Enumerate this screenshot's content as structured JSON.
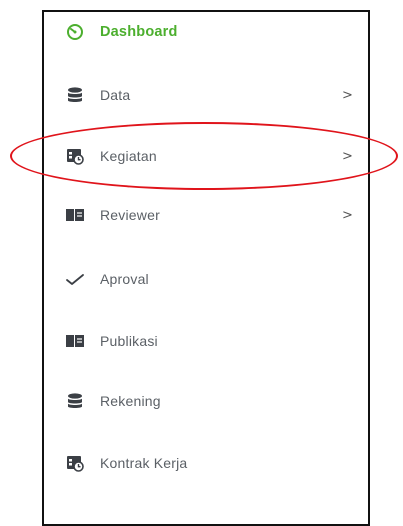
{
  "sidebar": {
    "items": [
      {
        "label": "Dashboard",
        "icon": "dashboard-gauge-icon",
        "chevron": ""
      },
      {
        "label": "Data",
        "icon": "database-icon",
        "chevron": ">"
      },
      {
        "label": "Kegiatan",
        "icon": "calendar-clock-icon",
        "chevron": ">"
      },
      {
        "label": "Reviewer",
        "icon": "book-icon",
        "chevron": ">"
      },
      {
        "label": "Aproval",
        "icon": "check-icon",
        "chevron": ""
      },
      {
        "label": "Publikasi",
        "icon": "book-icon",
        "chevron": ""
      },
      {
        "label": "Rekening",
        "icon": "database-icon",
        "chevron": ""
      },
      {
        "label": "Kontrak Kerja",
        "icon": "calendar-clock-icon",
        "chevron": ""
      }
    ]
  },
  "annotation": {
    "highlighted_item": "Kegiatan",
    "color": "#e0141b"
  },
  "colors": {
    "active": "#4caf2e",
    "text": "#5b6066",
    "icon": "#3b3f45"
  }
}
